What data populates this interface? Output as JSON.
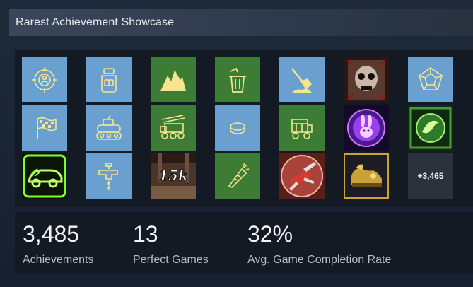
{
  "header": {
    "title": "Rarest Achievement Showcase"
  },
  "achievements": [
    {
      "icon": "target-person-icon",
      "bg": "blue"
    },
    {
      "icon": "backpack-icon",
      "bg": "blue"
    },
    {
      "icon": "mountains-icon",
      "bg": "green"
    },
    {
      "icon": "trash-bin-icon",
      "bg": "green"
    },
    {
      "icon": "shovel-icon",
      "bg": "blue"
    },
    {
      "icon": "skull-art-icon",
      "bg": "image"
    },
    {
      "icon": "dodecahedron-icon",
      "bg": "blue"
    },
    {
      "icon": "checkered-flag-icon",
      "bg": "blue"
    },
    {
      "icon": "tank-icon",
      "bg": "blue"
    },
    {
      "icon": "artillery-truck-icon",
      "bg": "green"
    },
    {
      "icon": "coin-icon",
      "bg": "blue"
    },
    {
      "icon": "wagon-icon",
      "bg": "green"
    },
    {
      "icon": "purple-rabbit-icon",
      "bg": "image"
    },
    {
      "icon": "green-glyph-icon",
      "bg": "image"
    },
    {
      "icon": "neon-car-icon",
      "bg": "image"
    },
    {
      "icon": "faucet-icon",
      "bg": "blue"
    },
    {
      "icon": "15k-badge-icon",
      "bg": "image",
      "text": "15k"
    },
    {
      "icon": "carrot-icon",
      "bg": "green"
    },
    {
      "icon": "swiss-knife-icon",
      "bg": "image"
    },
    {
      "icon": "gold-shoe-icon",
      "bg": "image"
    }
  ],
  "more_count": "+3,465",
  "stats": [
    {
      "value": "3,485",
      "label": "Achievements"
    },
    {
      "value": "13",
      "label": "Perfect Games"
    },
    {
      "value": "32%",
      "label": "Avg. Game Completion Rate"
    }
  ],
  "colors": {
    "tile_blue": "#69a0cf",
    "tile_green": "#3c7c35",
    "icon_yellow": "#f6e58d"
  }
}
